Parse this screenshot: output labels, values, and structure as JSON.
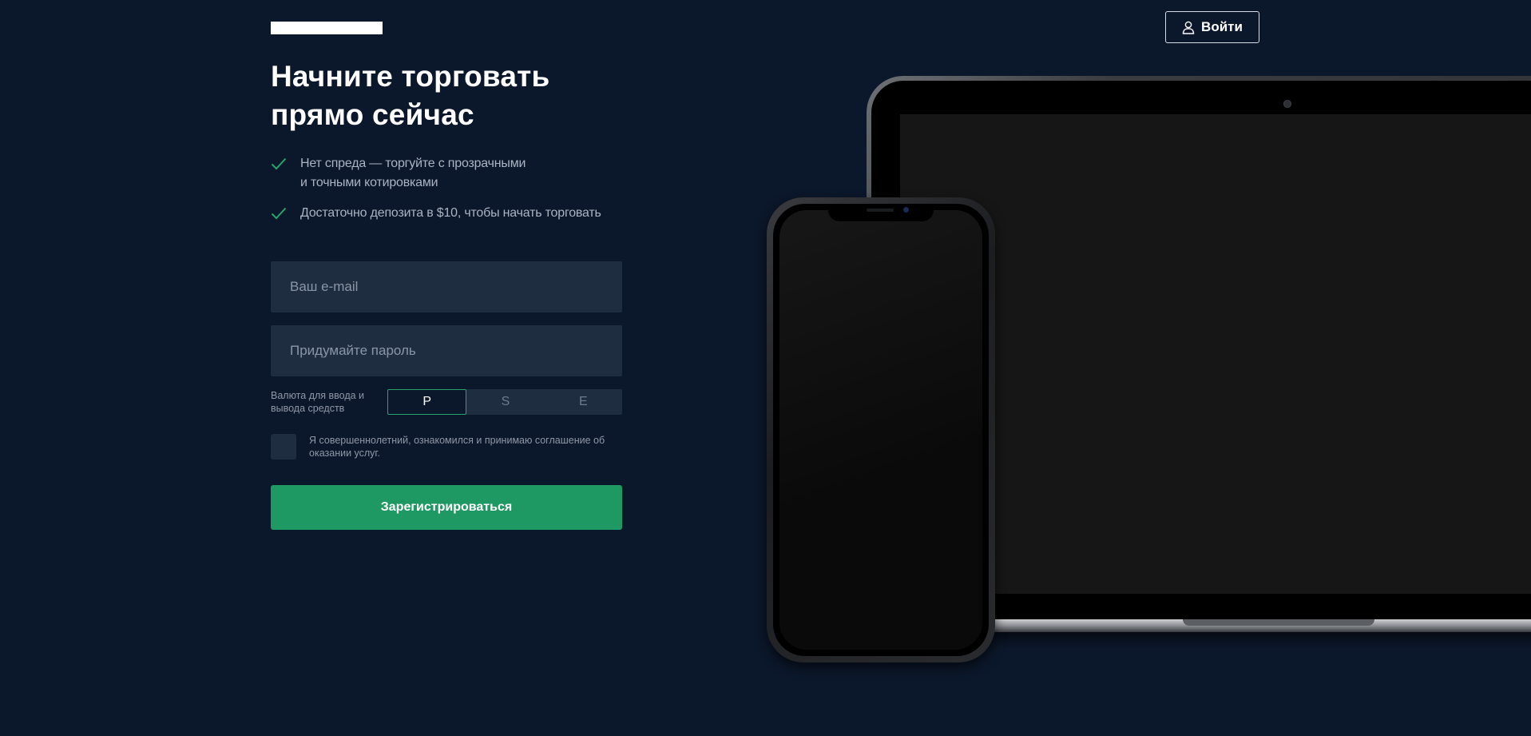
{
  "header": {
    "login_label": "Войти",
    "login_icon": "user-icon"
  },
  "hero": {
    "title_line1": "Начните торговать",
    "title_line2": "прямо сейчас",
    "features": [
      {
        "icon": "check-icon",
        "line1": "Нет спреда — торгуйте с прозрачными",
        "line2": "и точными котировками"
      },
      {
        "icon": "check-icon",
        "line1": "Достаточно депозита в $10, чтобы начать торговать",
        "line2": ""
      }
    ]
  },
  "form": {
    "email_placeholder": "Ваш e-mail",
    "email_value": "",
    "password_placeholder": "Придумайте пароль",
    "password_value": "",
    "currency_label_line1": "Валюта для ввода и",
    "currency_label_line2": "вывода средств",
    "currency_options": [
      "Р",
      "S",
      "E"
    ],
    "currency_selected": "Р",
    "agree_text": "Я совершеннолетний, ознакомился и принимаю соглашение об оказании услуг.",
    "agree_checked": false,
    "submit_label": "Зарегистрироваться"
  },
  "colors": {
    "background": "#0b172a",
    "field_background": "#1f2d40",
    "accent_green": "#1f9963",
    "check_green": "#27a36b",
    "muted_text": "#aab4c3"
  }
}
